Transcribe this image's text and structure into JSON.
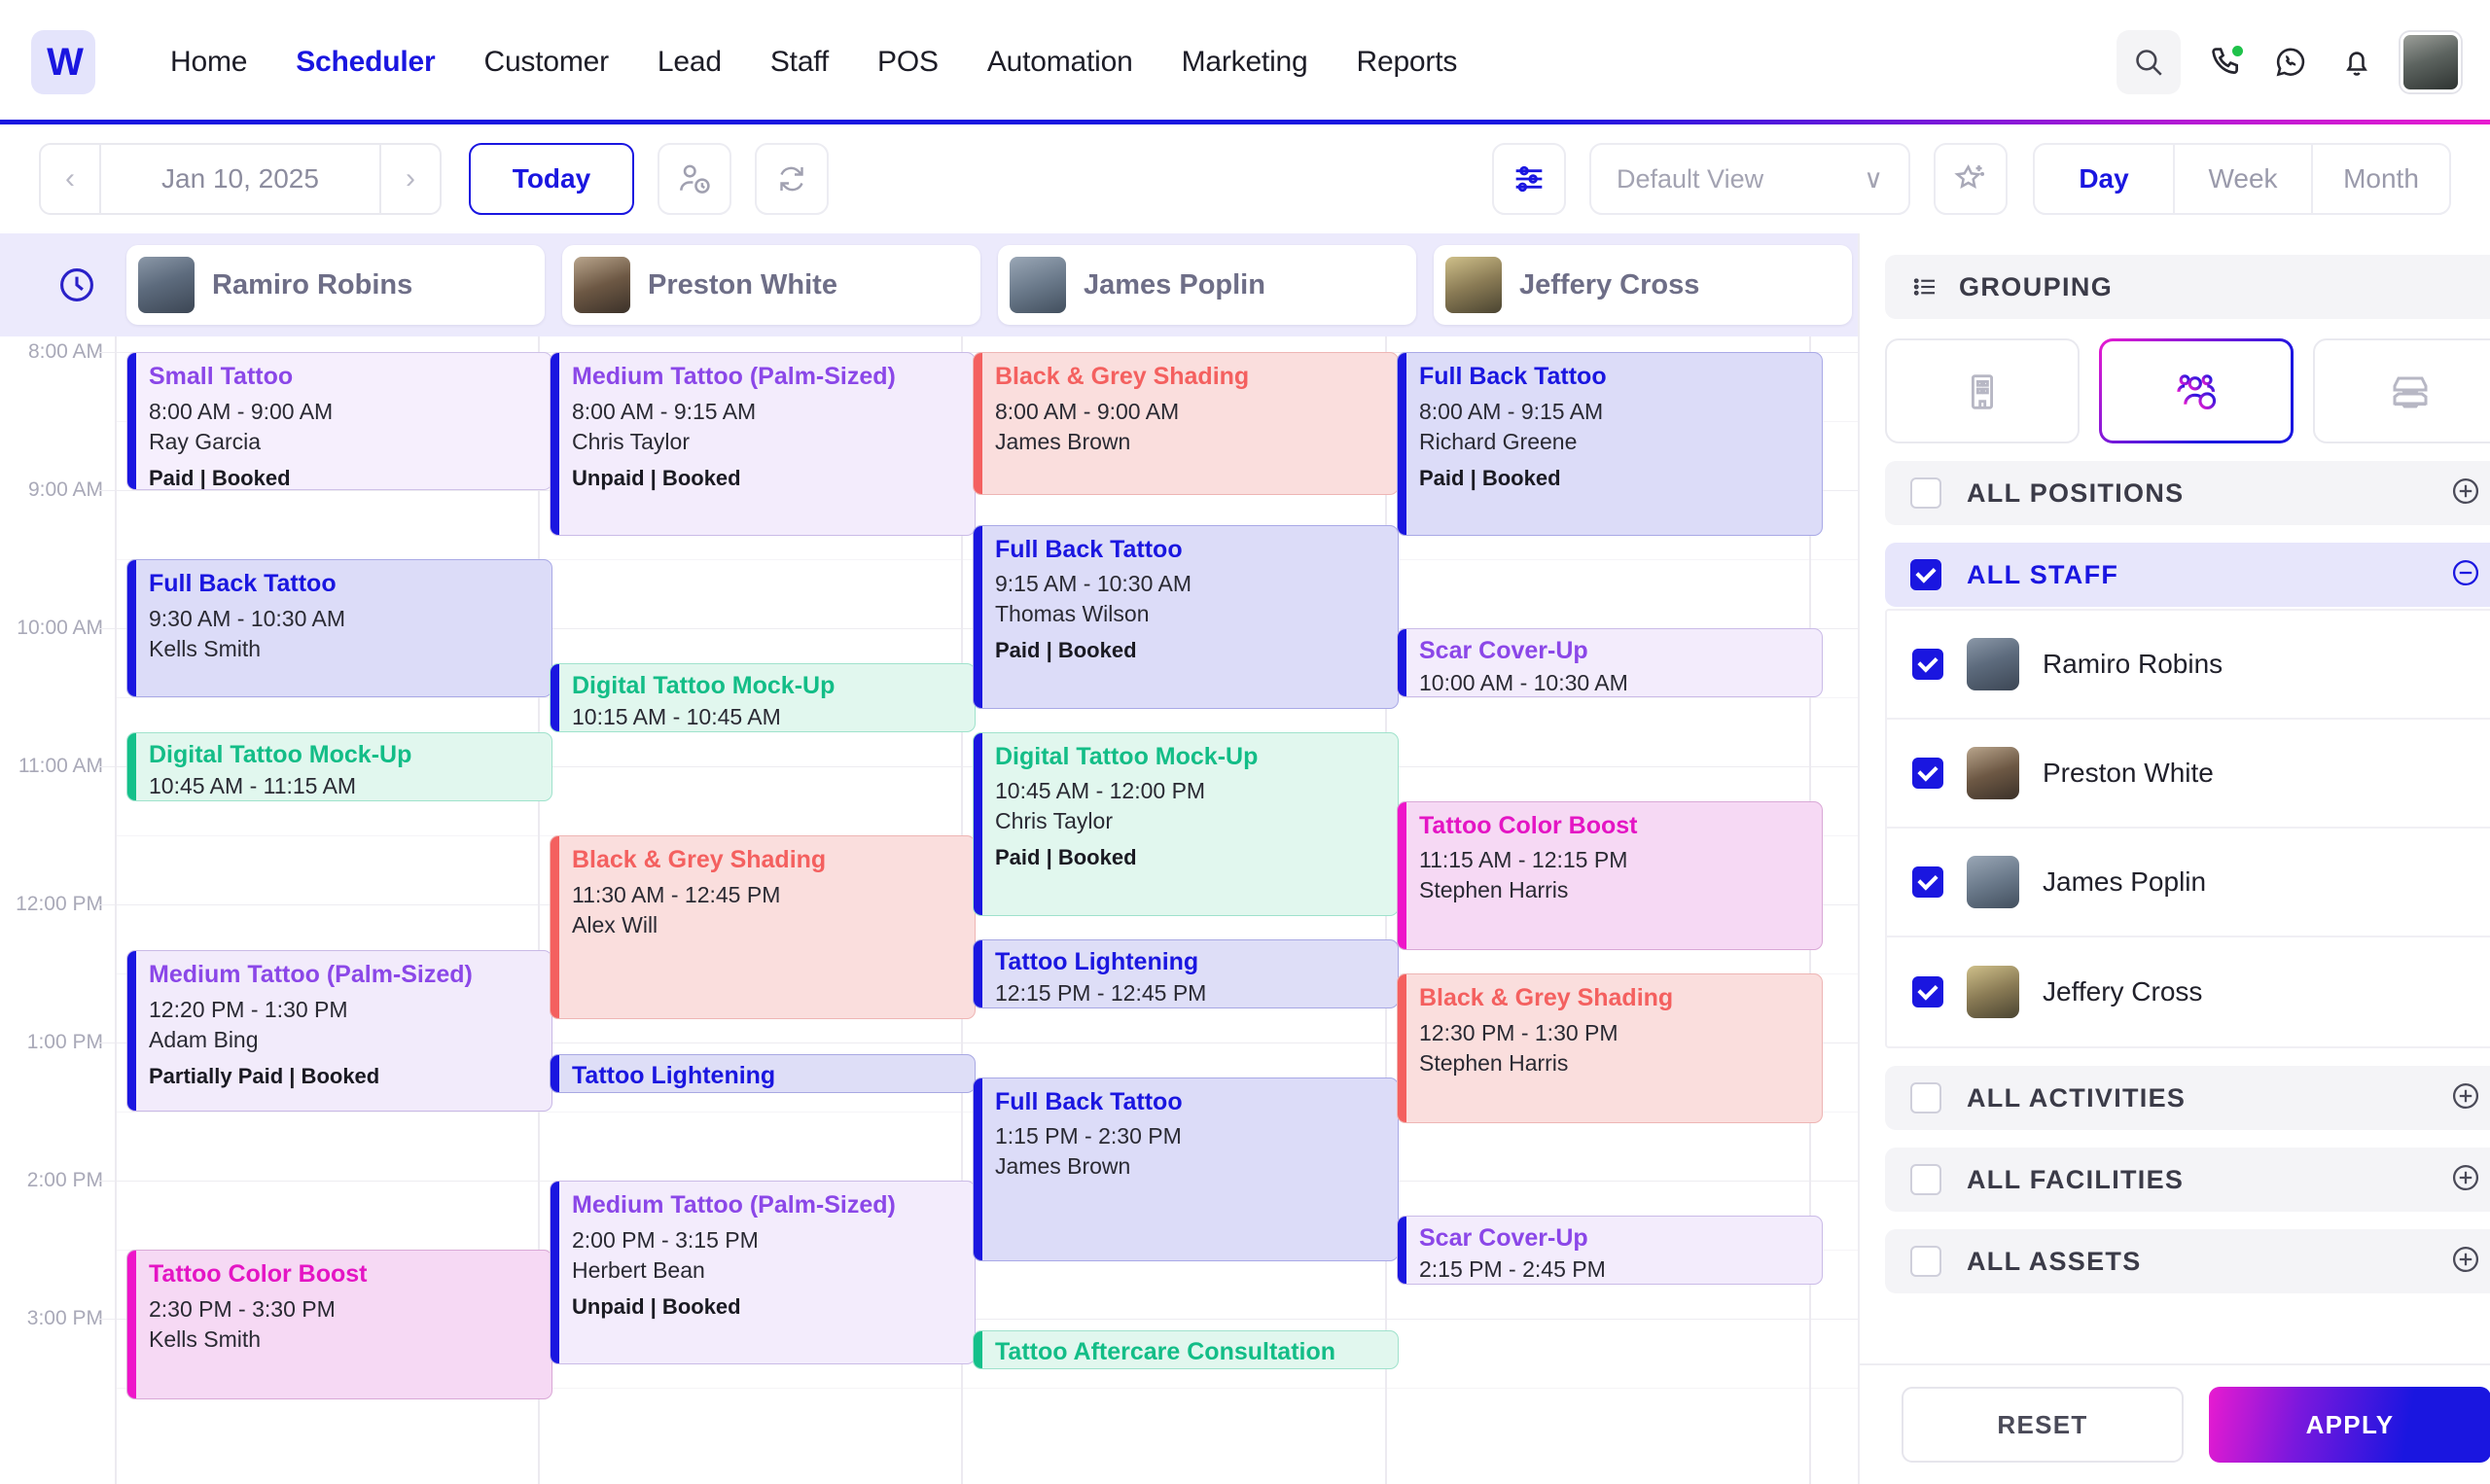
{
  "brand": {
    "logo_glyph": "W",
    "accent": "#1a16e0",
    "accent2": "#e81bd0"
  },
  "nav": {
    "items": [
      {
        "label": "Home",
        "active": false
      },
      {
        "label": "Scheduler",
        "active": true
      },
      {
        "label": "Customer",
        "active": false
      },
      {
        "label": "Lead",
        "active": false
      },
      {
        "label": "Staff",
        "active": false
      },
      {
        "label": "POS",
        "active": false
      },
      {
        "label": "Automation",
        "active": false
      },
      {
        "label": "Marketing",
        "active": false
      },
      {
        "label": "Reports",
        "active": false
      }
    ],
    "right_icons": [
      "search-icon",
      "phone-call-icon",
      "whatsapp-icon",
      "bell-icon",
      "user-avatar"
    ]
  },
  "toolbar": {
    "prev_label": "‹",
    "next_label": "›",
    "date": "Jan 10, 2025",
    "today_label": "Today",
    "staff_clock_icon": "user-clock-icon",
    "refresh_icon": "refresh-icon",
    "filter_icon": "filter-sliders-icon",
    "view_value": "Default View",
    "view_chevron": "∨",
    "favorite_icon": "star-plus-icon",
    "ranges": [
      {
        "label": "Day",
        "active": true
      },
      {
        "label": "Week",
        "active": false
      },
      {
        "label": "Month",
        "active": false
      }
    ]
  },
  "calendar": {
    "clock_icon": "clock-icon",
    "columns": [
      {
        "name": "Ramiro Robins",
        "avatar": "ph1"
      },
      {
        "name": "Preston White",
        "avatar": "ph2"
      },
      {
        "name": "James Poplin",
        "avatar": "ph3"
      },
      {
        "name": "Jeffery Cross",
        "avatar": "ph4"
      }
    ],
    "time_labels": [
      "8:00 AM",
      "9:00 AM",
      "10:00 AM",
      "11:00 AM",
      "12:00 PM",
      "1:00 PM",
      "2:00 PM",
      "3:00 PM"
    ],
    "events": [
      {
        "col": 0,
        "title": "Small Tattoo",
        "time": "8:00 AM - 9:00 AM",
        "who": "Ray Garcia",
        "status": "Paid | Booked",
        "start": "08:00",
        "end": "09:00",
        "fill": "#f6effd",
        "rail": "#1a16e0",
        "title_color": "#8b47e8",
        "border": "#cfc1e8"
      },
      {
        "col": 0,
        "title": "Full Back Tattoo",
        "time": "9:30 AM - 10:30 AM",
        "who": "Kells Smith",
        "status": "",
        "start": "09:30",
        "end": "10:30",
        "fill": "#dcdcf8",
        "rail": "#1a16e0",
        "title_color": "#1a16e0",
        "border": "#a9a9e6"
      },
      {
        "col": 0,
        "title": "Digital Tattoo Mock-Up",
        "time": "10:45 AM - 11:15 AM",
        "who": "",
        "status": "",
        "start": "10:45",
        "end": "11:15",
        "fill": "#e1f7ee",
        "rail": "#14c08a",
        "title_color": "#13bd87",
        "border": "#9fe2cc"
      },
      {
        "col": 0,
        "title": "Medium Tattoo (Palm-Sized)",
        "time": "12:20 PM - 1:30 PM",
        "who": "Adam Bing",
        "status": "Partially Paid | Booked",
        "start": "12:20",
        "end": "13:30",
        "fill": "#f2ebfb",
        "rail": "#1a16e0",
        "title_color": "#8b47e8",
        "border": "#c9b9e6"
      },
      {
        "col": 0,
        "title": "Tattoo Color Boost",
        "time": "2:30 PM - 3:30 PM",
        "who": "Kells Smith",
        "status": "",
        "start": "14:30",
        "end": "15:35",
        "fill": "#f6d9f4",
        "rail": "#ee15c9",
        "title_color": "#e415c4",
        "border": "#d9a8d6"
      },
      {
        "col": 1,
        "title": "Medium Tattoo (Palm-Sized)",
        "time": "8:00 AM - 9:15 AM",
        "who": "Chris Taylor",
        "status": "Unpaid | Booked",
        "start": "08:00",
        "end": "09:20",
        "fill": "#f3ecfc",
        "rail": "#1a16e0",
        "title_color": "#8b47e8",
        "border": "#cabbe7"
      },
      {
        "col": 1,
        "title": "Digital Tattoo Mock-Up",
        "time": "10:15 AM - 10:45 AM",
        "who": "",
        "status": "",
        "start": "10:15",
        "end": "10:45",
        "fill": "#e1f7ee",
        "rail": "#1a16e0",
        "title_color": "#13bd87",
        "border": "#9fe2cc"
      },
      {
        "col": 1,
        "title": "Black & Grey Shading",
        "time": "11:30 AM - 12:45 PM",
        "who": "Alex Will",
        "status": "",
        "start": "11:30",
        "end": "12:50",
        "fill": "#fadedd",
        "rail": "#f4605f",
        "title_color": "#f4605f",
        "border": "#eeb5b4"
      },
      {
        "col": 1,
        "title": "Tattoo Lightening",
        "time": "",
        "who": "",
        "status": "",
        "start": "13:05",
        "end": "13:22",
        "fill": "#dedef7",
        "rail": "#1a16e0",
        "title_color": "#1a16e0",
        "border": "#a8a8e3"
      },
      {
        "col": 1,
        "title": "Medium Tattoo (Palm-Sized)",
        "time": "2:00 PM - 3:15 PM",
        "who": "Herbert Bean",
        "status": "Unpaid | Booked",
        "start": "14:00",
        "end": "15:20",
        "fill": "#f3ecfc",
        "rail": "#1a16e0",
        "title_color": "#8b47e8",
        "border": "#cabbe7"
      },
      {
        "col": 2,
        "title": "Black & Grey Shading",
        "time": "8:00 AM - 9:00 AM",
        "who": "James Brown",
        "status": "",
        "start": "08:00",
        "end": "09:02",
        "fill": "#fadedd",
        "rail": "#f4605f",
        "title_color": "#f4605f",
        "border": "#eeb5b4"
      },
      {
        "col": 2,
        "title": "Full Back Tattoo",
        "time": "9:15 AM - 10:30 AM",
        "who": "Thomas Wilson",
        "status": "Paid | Booked",
        "start": "09:15",
        "end": "10:35",
        "fill": "#dcdcf8",
        "rail": "#1a16e0",
        "title_color": "#1a16e0",
        "border": "#a9a9e6"
      },
      {
        "col": 2,
        "title": "Digital Tattoo Mock-Up",
        "time": "10:45 AM - 12:00 PM",
        "who": "Chris Taylor",
        "status": "Paid | Booked",
        "start": "10:45",
        "end": "12:05",
        "fill": "#e1f7ee",
        "rail": "#1a16e0",
        "title_color": "#13bd87",
        "border": "#9fe2cc"
      },
      {
        "col": 2,
        "title": "Tattoo Lightening",
        "time": "12:15 PM - 12:45 PM",
        "who": "",
        "status": "",
        "start": "12:15",
        "end": "12:45",
        "fill": "#dedef7",
        "rail": "#1a16e0",
        "title_color": "#1a16e0",
        "border": "#a8a8e3"
      },
      {
        "col": 2,
        "title": "Full Back Tattoo",
        "time": "1:15 PM - 2:30 PM",
        "who": "James Brown",
        "status": "",
        "start": "13:15",
        "end": "14:35",
        "fill": "#dcdcf8",
        "rail": "#1a16e0",
        "title_color": "#1a16e0",
        "border": "#a9a9e6"
      },
      {
        "col": 2,
        "title": "Tattoo Aftercare Consultation",
        "time": "",
        "who": "",
        "status": "",
        "start": "15:05",
        "end": "15:22",
        "fill": "#e1f7ee",
        "rail": "#14c08a",
        "title_color": "#13bd87",
        "border": "#9fe2cc"
      },
      {
        "col": 3,
        "title": "Full Back Tattoo",
        "time": "8:00 AM - 9:15 AM",
        "who": "Richard Greene",
        "status": "Paid | Booked",
        "start": "08:00",
        "end": "09:20",
        "fill": "#dcdcf8",
        "rail": "#1a16e0",
        "title_color": "#1a16e0",
        "border": "#a9a9e6"
      },
      {
        "col": 3,
        "title": "Scar Cover-Up",
        "time": "10:00 AM - 10:30 AM",
        "who": "",
        "status": "",
        "start": "10:00",
        "end": "10:30",
        "fill": "#f3ecfc",
        "rail": "#1a16e0",
        "title_color": "#8b47e8",
        "border": "#cabbe7"
      },
      {
        "col": 3,
        "title": "Tattoo Color Boost",
        "time": "11:15 AM - 12:15 PM",
        "who": "Stephen Harris",
        "status": "",
        "start": "11:15",
        "end": "12:20",
        "fill": "#f6d9f4",
        "rail": "#ee15c9",
        "title_color": "#e415c4",
        "border": "#d9a8d6"
      },
      {
        "col": 3,
        "title": "Black & Grey Shading",
        "time": "12:30 PM - 1:30 PM",
        "who": "Stephen Harris",
        "status": "",
        "start": "12:30",
        "end": "13:35",
        "fill": "#fadedd",
        "rail": "#f4605f",
        "title_color": "#f4605f",
        "border": "#eeb5b4"
      },
      {
        "col": 3,
        "title": "Scar Cover-Up",
        "time": "2:15 PM - 2:45 PM",
        "who": "",
        "status": "",
        "start": "14:15",
        "end": "14:45",
        "fill": "#f3ecfc",
        "rail": "#1a16e0",
        "title_color": "#8b47e8",
        "border": "#cabbe7"
      }
    ]
  },
  "panel": {
    "header": {
      "title": "GROUPING",
      "icon": "list-icon"
    },
    "modes": [
      {
        "icon": "building-icon",
        "active": false
      },
      {
        "icon": "people-add-icon",
        "active": true
      },
      {
        "icon": "trays-icon",
        "active": false
      }
    ],
    "groups": [
      {
        "label": "ALL POSITIONS",
        "checked": false,
        "expanded": false,
        "toggle": "+"
      },
      {
        "label": "ALL STAFF",
        "checked": true,
        "expanded": true,
        "toggle": "−"
      },
      {
        "label": "ALL ACTIVITIES",
        "checked": false,
        "expanded": false,
        "toggle": "+"
      },
      {
        "label": "ALL FACILITIES",
        "checked": false,
        "expanded": false,
        "toggle": "+"
      },
      {
        "label": "ALL ASSETS",
        "checked": false,
        "expanded": false,
        "toggle": "+"
      }
    ],
    "staff": [
      {
        "name": "Ramiro Robins",
        "checked": true,
        "avatar": "ph1"
      },
      {
        "name": "Preston White",
        "checked": true,
        "avatar": "ph2"
      },
      {
        "name": "James Poplin",
        "checked": true,
        "avatar": "ph3"
      },
      {
        "name": "Jeffery Cross",
        "checked": true,
        "avatar": "ph4"
      }
    ],
    "footer": {
      "reset_label": "RESET",
      "apply_label": "APPLY"
    }
  }
}
